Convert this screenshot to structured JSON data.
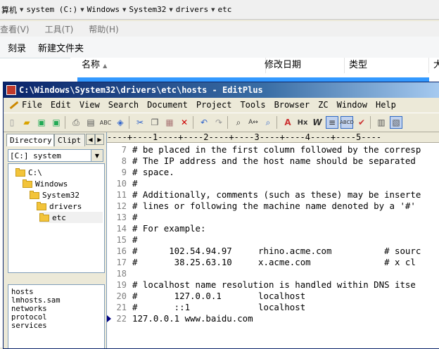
{
  "explorer": {
    "breadcrumb": [
      "算机",
      "system (C:)",
      "Windows",
      "System32",
      "drivers",
      "etc"
    ],
    "menu": [
      "查看(V)",
      "工具(T)",
      "帮助(H)"
    ],
    "toolbar": [
      "刻录",
      "新建文件夹"
    ],
    "columns": [
      "名称",
      "修改日期",
      "类型",
      "大"
    ]
  },
  "editplus": {
    "title": "C:\\Windows\\System32\\drivers\\etc\\hosts - EditPlus",
    "menu": [
      "File",
      "Edit",
      "View",
      "Search",
      "Document",
      "Project",
      "Tools",
      "Browser",
      "ZC",
      "Window",
      "Help"
    ],
    "tabs": [
      "Directory",
      "Clipt"
    ],
    "drive": "[C:] system",
    "tree": [
      "C:\\",
      "Windows",
      "System32",
      "drivers",
      "etc"
    ],
    "files": [
      "hosts",
      "lmhosts.sam",
      "networks",
      "protocol",
      "services"
    ],
    "ruler": "----+----1----+----2----+----3----+----4----+----5----",
    "lines": [
      {
        "num": "7",
        "text": "# be placed in the first column followed by the corresp"
      },
      {
        "num": "8",
        "text": "# The IP address and the host name should be separated"
      },
      {
        "num": "9",
        "text": "# space."
      },
      {
        "num": "10",
        "text": "#"
      },
      {
        "num": "11",
        "text": "# Additionally, comments (such as these) may be inserte"
      },
      {
        "num": "12",
        "text": "# lines or following the machine name denoted by a '#'"
      },
      {
        "num": "13",
        "text": "#"
      },
      {
        "num": "14",
        "text": "# For example:"
      },
      {
        "num": "15",
        "text": "#"
      },
      {
        "num": "16",
        "text": "#      102.54.94.97     rhino.acme.com          # sourc"
      },
      {
        "num": "17",
        "text": "#       38.25.63.10     x.acme.com              # x cl"
      },
      {
        "num": "18",
        "text": ""
      },
      {
        "num": "19",
        "text": "# localhost name resolution is handled within DNS itse"
      },
      {
        "num": "20",
        "text": "#       127.0.0.1       localhost"
      },
      {
        "num": "21",
        "text": "#       ::1             localhost"
      },
      {
        "num": "22",
        "text": "127.0.0.1 www.baidu.com"
      }
    ]
  }
}
